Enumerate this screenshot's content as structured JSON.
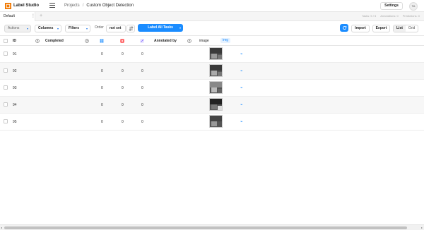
{
  "app": {
    "brand": "Label Studio"
  },
  "breadcrumb": {
    "projects": "Projects",
    "separator": "/",
    "current": "Custom Object Detection"
  },
  "header": {
    "settings_label": "Settings",
    "avatar_initials": "TA"
  },
  "tabs": {
    "active_label": "Default",
    "menu_glyph": "⋮",
    "add_glyph": "+"
  },
  "stats": {
    "tasks": "Tasks: 5 / 5",
    "annotations": "Annotations: 0",
    "predictions": "Predictions: 0"
  },
  "toolbar": {
    "actions_label": "Actions",
    "columns_label": "Columns",
    "filters_label": "Filters",
    "order_label": "Order",
    "order_value": "not set",
    "label_all_label": "Label All Tasks",
    "import_label": "Import",
    "export_label": "Export",
    "view_list": "List",
    "view_grid": "Grid",
    "caret_glyph": "▾"
  },
  "table": {
    "headers": {
      "id": "ID",
      "completed": "Completed",
      "annotated_by": "Annotated by",
      "image": "image",
      "img_badge": "img"
    },
    "rows": [
      {
        "id": "91",
        "total": "0",
        "cancelled": "0",
        "predictions": "0"
      },
      {
        "id": "92",
        "total": "0",
        "cancelled": "0",
        "predictions": "0"
      },
      {
        "id": "93",
        "total": "0",
        "cancelled": "0",
        "predictions": "0"
      },
      {
        "id": "94",
        "total": "0",
        "cancelled": "0",
        "predictions": "0"
      },
      {
        "id": "95",
        "total": "0",
        "cancelled": "0",
        "predictions": "0"
      }
    ],
    "waveform_glyph": "⌁"
  },
  "colors": {
    "accent": "#1a8cff",
    "brand": "#f07800",
    "row_alt": "#f7f7f7"
  },
  "icons": [
    "logo-icon",
    "hamburger-icon",
    "refresh-icon",
    "help-icon",
    "total-annotations-icon",
    "cancelled-icon",
    "predictions-icon",
    "waveform-icon",
    "sort-icon"
  ]
}
